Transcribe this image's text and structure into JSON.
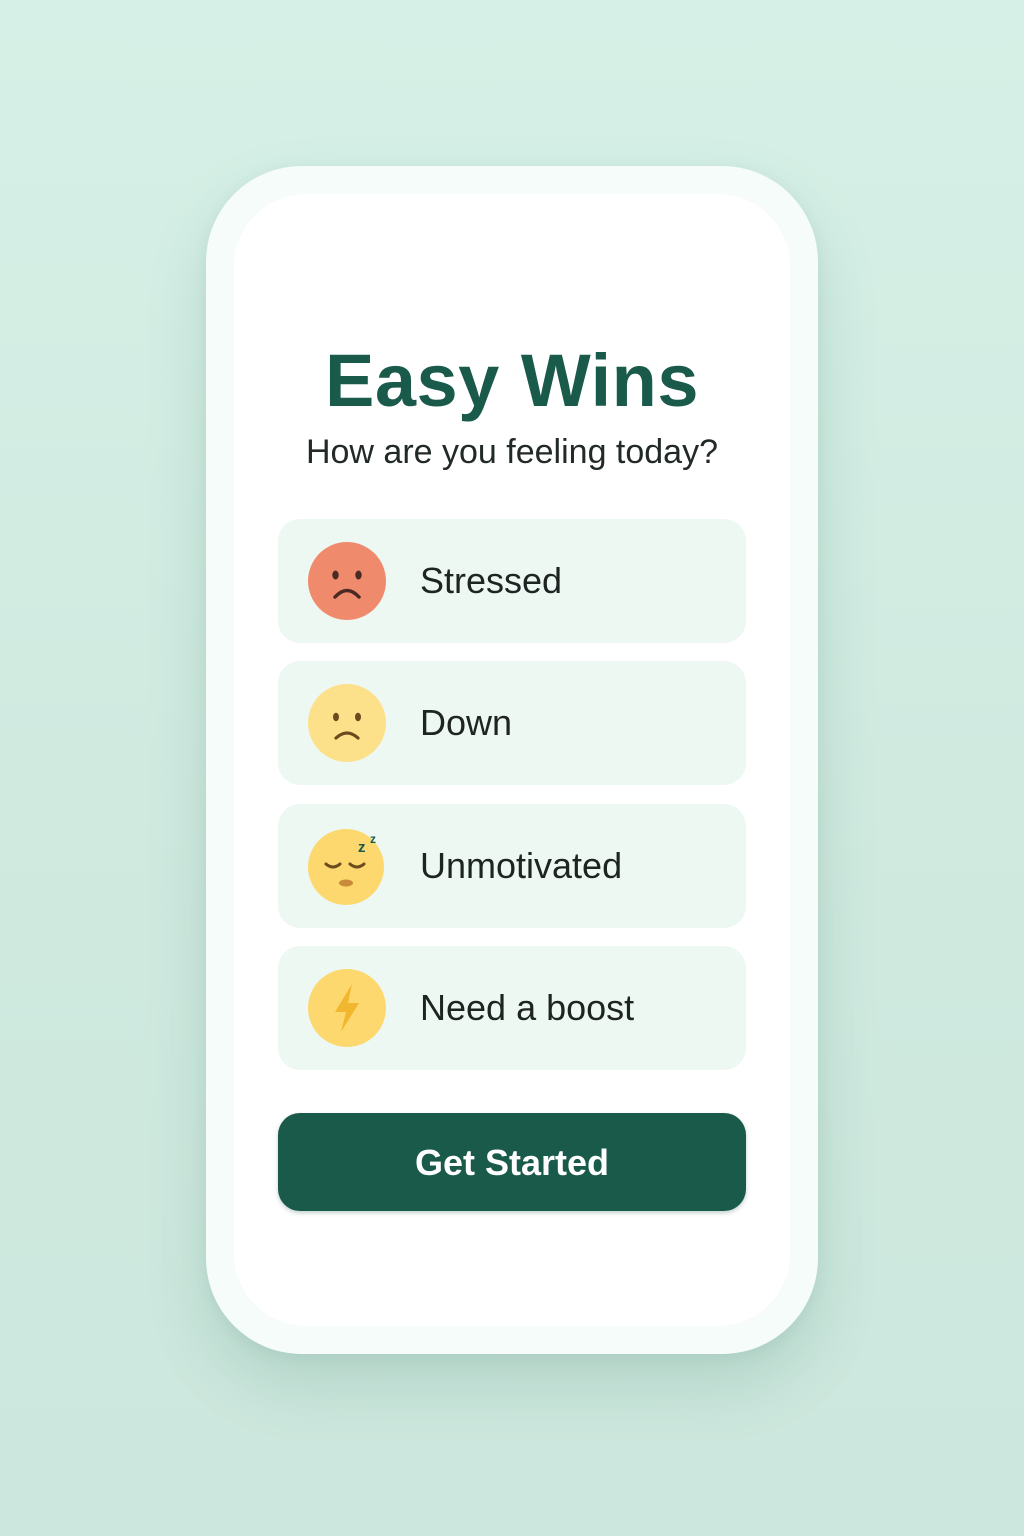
{
  "app": {
    "title": "Easy Wins",
    "subtitle": "How are you feeling today?"
  },
  "moods": [
    {
      "label": "Stressed",
      "icon": "stressed-face-icon",
      "color": "#f08a6c"
    },
    {
      "label": "Down",
      "icon": "sad-face-icon",
      "color": "#fde08a"
    },
    {
      "label": "Unmotivated",
      "icon": "sleepy-face-icon",
      "color": "#fcd86f"
    },
    {
      "label": "Need a boost",
      "icon": "lightning-bolt-icon",
      "color": "#fcd86f"
    }
  ],
  "cta": {
    "label": "Get Started",
    "color": "#1a5a4b"
  }
}
